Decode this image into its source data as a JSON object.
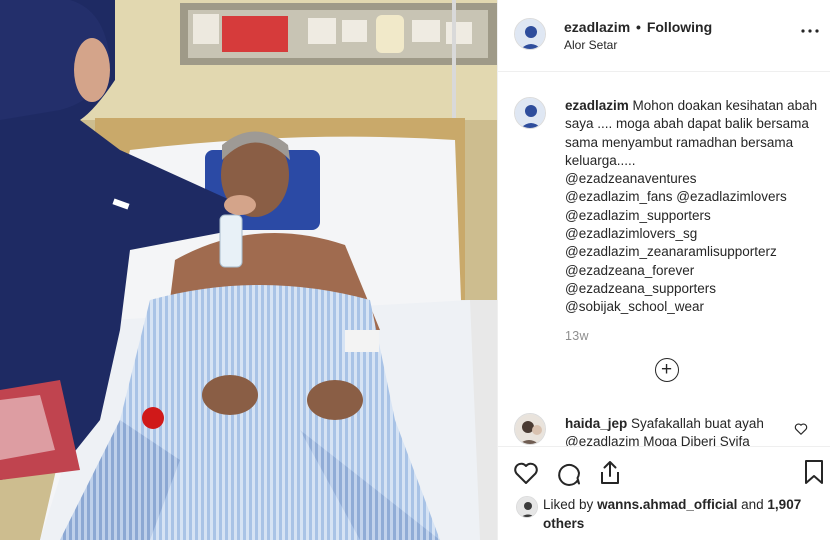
{
  "post": {
    "username": "ezadlazim",
    "separator": "•",
    "follow_status": "Following",
    "location": "Alor Setar"
  },
  "caption": {
    "username": "ezadlazim",
    "text": "Mohon doakan kesihatan abah saya .... moga abah dapat balik bersama sama menyambut ramadhan bersama keluarga.....",
    "tags": [
      "@ezadzeanaventures",
      "@ezadlazim_fans @ezadlazimlovers",
      "@ezadlazim_supporters",
      "@ezadlazimlovers_sg",
      "@ezadlazim_zeanaramlisupporterz",
      "@ezadzeana_forever",
      "@ezadzeana_supporters",
      "@sobijak_school_wear"
    ],
    "time_ago": "13w"
  },
  "comment": {
    "username": "haida_jep",
    "text": "Syafakallah buat ayah @ezadlazim Moga Diberi Syifa"
  },
  "likes": {
    "prefix": "Liked by",
    "liker": "wanns.ahmad_official",
    "connector": "and",
    "others": "1,907 others"
  },
  "icons": {
    "more": "more-options-icon",
    "load_more": "plus-circle-icon",
    "like": "heart-icon",
    "comment": "comment-icon",
    "share": "share-icon",
    "save": "bookmark-icon"
  },
  "colors": {
    "text": "#262626",
    "muted": "#8e8e8e",
    "divider": "#efefef"
  }
}
